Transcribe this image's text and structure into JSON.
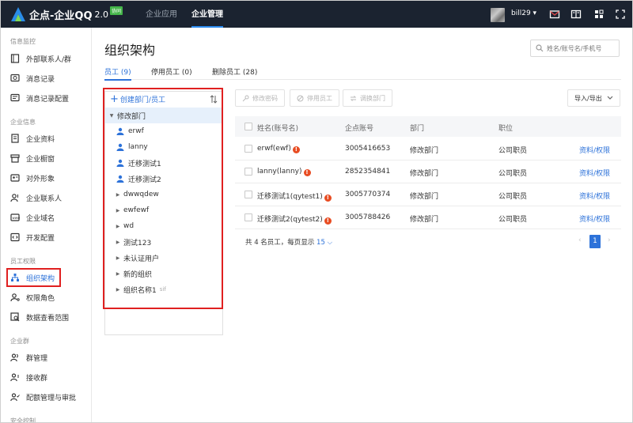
{
  "app": {
    "name": "企点-企业QQ",
    "version": "2.0",
    "badge": "协同",
    "nav": [
      "企业应用",
      "企业管理"
    ],
    "user": "bill29",
    "user_caret": "▾"
  },
  "sidebar": {
    "sections": [
      {
        "title": "信息监控",
        "items": [
          "外部联系人/群",
          "消息记录",
          "消息记录配置"
        ]
      },
      {
        "title": "企业信息",
        "items": [
          "企业资料",
          "企业橱窗",
          "对外形象",
          "企业联系人",
          "企业域名",
          "开发配置"
        ]
      },
      {
        "title": "员工权限",
        "items": [
          "组织架构",
          "权限角色",
          "数据查看范围"
        ]
      },
      {
        "title": "企业群",
        "items": [
          "群管理",
          "接收群",
          "配额管理与审批"
        ]
      },
      {
        "title": "安全控制",
        "items": []
      }
    ]
  },
  "main": {
    "title": "组织架构",
    "search_placeholder": "姓名/账号名/手机号",
    "tabs": [
      "员工 (9)",
      "停用员工 (0)",
      "删除员工 (28)"
    ],
    "tree": {
      "create_label": "创建部门/员工",
      "root": "修改部门",
      "users": [
        "erwf",
        "lanny",
        "迁移测试1",
        "迁移测试2"
      ],
      "depts": [
        "dwwqdew",
        "ewfewf",
        "wd",
        "测试123",
        "未认证用户",
        "新的组织",
        "组织名称1"
      ],
      "dept_suffix": "sif"
    },
    "toolbar": {
      "change_password": "修改密码",
      "disable_staff": "停用员工",
      "move_dept": "调换部门",
      "import_export": "导入/导出"
    },
    "table": {
      "headers": [
        "姓名(账号名)",
        "企点账号",
        "部门",
        "职位"
      ],
      "rows": [
        {
          "name": "erwf(ewf)",
          "account": "3005416653",
          "dept": "修改部门",
          "title": "公司职员",
          "action": "资料/权限"
        },
        {
          "name": "lanny(lanny)",
          "account": "2852354841",
          "dept": "修改部门",
          "title": "公司职员",
          "action": "资料/权限"
        },
        {
          "name": "迁移测试1(qytest1)",
          "account": "3005770374",
          "dept": "修改部门",
          "title": "公司职员",
          "action": "资料/权限"
        },
        {
          "name": "迁移测试2(qytest2)",
          "account": "3005788426",
          "dept": "修改部门",
          "title": "公司职员",
          "action": "资料/权限"
        }
      ]
    },
    "footer": {
      "summary": "共 4 名员工，每页显示",
      "page_size": "15",
      "current_page": "1"
    }
  },
  "colors": {
    "accent": "#2d72d9",
    "topbar": "#1b2330",
    "highlight": "#e02020",
    "warn": "#e84c22"
  }
}
